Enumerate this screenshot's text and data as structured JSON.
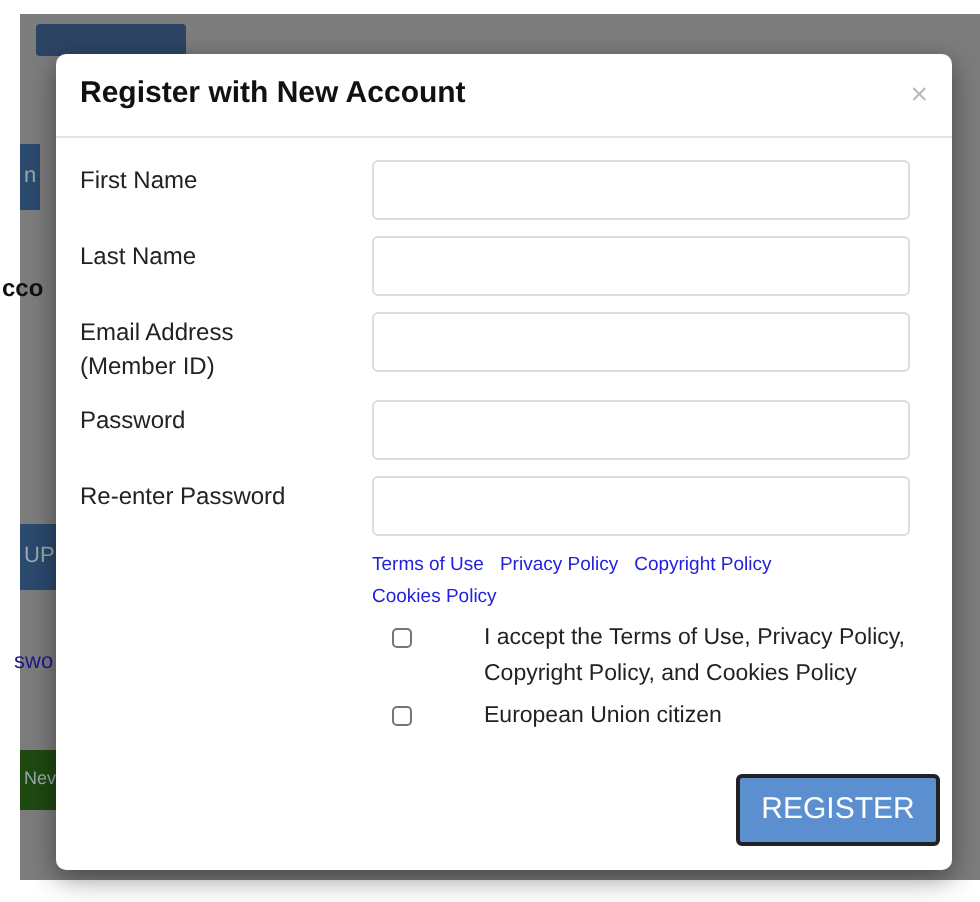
{
  "background": {
    "items": [
      {
        "kind": "button",
        "text": "n",
        "color": "#2b4a6e"
      },
      {
        "kind": "heading",
        "text": "cco"
      },
      {
        "kind": "button",
        "text": "UP",
        "color": "#2b4a6e"
      },
      {
        "kind": "link",
        "text": "swo"
      },
      {
        "kind": "button",
        "text": "Nev",
        "color": "#1e4a12"
      }
    ]
  },
  "modal": {
    "title": "Register with New Account",
    "close": "×",
    "fields": [
      {
        "label": "First Name"
      },
      {
        "label": "Last Name"
      },
      {
        "label": "Email Address (Member ID)"
      },
      {
        "label": "Password"
      },
      {
        "label": "Re-enter Password"
      }
    ],
    "links": [
      "Terms of Use",
      "Privacy Policy",
      "Copyright Policy",
      "Cookies Policy"
    ],
    "checkboxes": [
      {
        "label": "I accept the Terms of Use, Privacy Policy, Copyright Policy, and Cookies Policy",
        "checked": false
      },
      {
        "label": "European Union citizen",
        "checked": false
      }
    ],
    "submit": "REGISTER"
  }
}
